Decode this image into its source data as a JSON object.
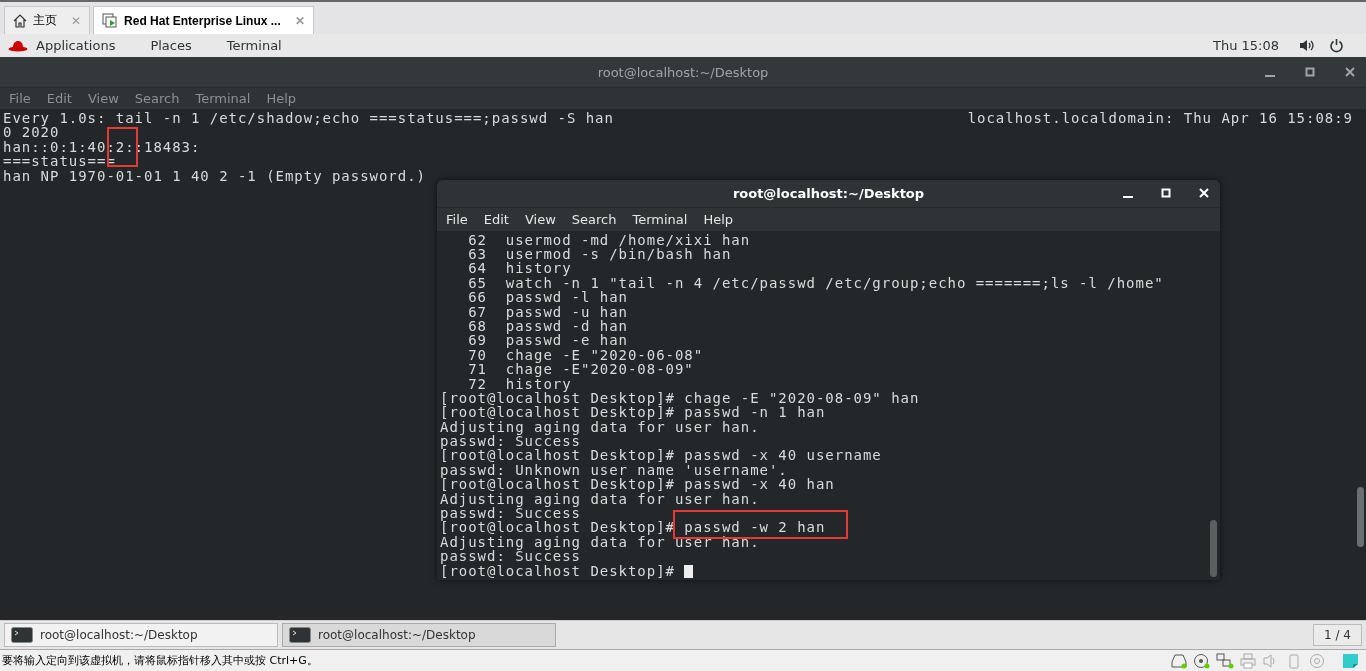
{
  "vm_tabs": [
    {
      "kind": "home",
      "label": "主页",
      "selected": false,
      "close": "✕"
    },
    {
      "kind": "vm",
      "label": "Red Hat Enterprise Linux ...",
      "selected": true,
      "close": "✕"
    }
  ],
  "top_bar": {
    "menus": [
      "Applications",
      "Places",
      "Terminal"
    ],
    "clock": "Thu 15:08"
  },
  "back_terminal": {
    "title": "root@localhost:~/Desktop",
    "menu": [
      "File",
      "Edit",
      "View",
      "Search",
      "Terminal",
      "Help"
    ],
    "header_left": "Every 1.0s: tail -n 1 /etc/shadow;echo ===status===;passwd -S han",
    "header_right": "localhost.localdomain: Thu Apr 16 15:08:9",
    "lines": [
      "0 2020",
      "han::0:1:40:2::18483:",
      "===status===",
      "han NP 1970-01-01 1 40 2 -1 (Empty password.)"
    ]
  },
  "front_terminal": {
    "title": "root@localhost:~/Desktop",
    "menu": [
      "File",
      "Edit",
      "View",
      "Search",
      "Terminal",
      "Help"
    ],
    "lines": [
      "   62  usermod -md /home/xixi han",
      "   63  usermod -s /bin/bash han",
      "   64  history",
      "   65  watch -n 1 \"tail -n 4 /etc/passwd /etc/group;echo =======;ls -l /home\"",
      "   66  passwd -l han",
      "   67  passwd -u han",
      "   68  passwd -d han",
      "   69  passwd -e han",
      "   70  chage -E \"2020-06-08\"",
      "   71  chage -E\"2020-08-09\"",
      "   72  history",
      "[root@localhost Desktop]# chage -E \"2020-08-09\" han",
      "[root@localhost Desktop]# passwd -n 1 han",
      "Adjusting aging data for user han.",
      "passwd: Success",
      "[root@localhost Desktop]# passwd -x 40 username",
      "passwd: Unknown user name 'username'.",
      "[root@localhost Desktop]# passwd -x 40 han",
      "Adjusting aging data for user han.",
      "passwd: Success",
      "[root@localhost Desktop]# passwd -w 2 han",
      "Adjusting aging data for user han.",
      "passwd: Success",
      "[root@localhost Desktop]# "
    ],
    "cursor": true
  },
  "taskbar": {
    "tasks": [
      {
        "label": "root@localhost:~/Desktop",
        "selected": false
      },
      {
        "label": "root@localhost:~/Desktop",
        "selected": true
      }
    ],
    "workspace": "1 / 4"
  },
  "status_bar": {
    "message": "要将输入定向到该虚拟机，请将鼠标指针移入其中或按 Ctrl+G。"
  }
}
